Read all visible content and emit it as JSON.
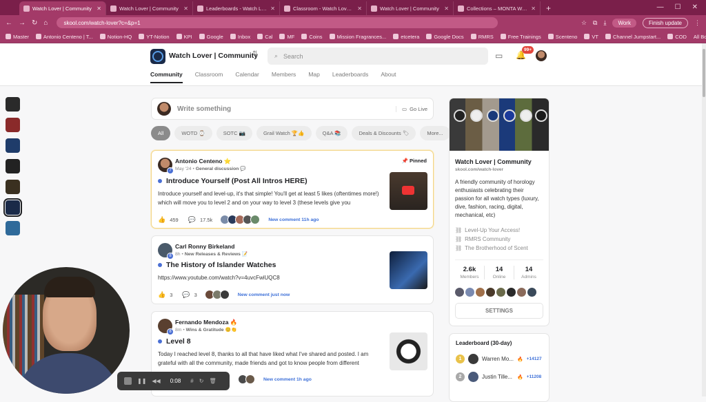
{
  "browser": {
    "tabs": [
      {
        "label": "Watch Lover | Community",
        "active": true
      },
      {
        "label": "Watch Lover | Community",
        "active": false
      },
      {
        "label": "Leaderboards - Watch Lover | C",
        "active": false
      },
      {
        "label": "Classroom - Watch Lover | Com",
        "active": false
      },
      {
        "label": "Watch Lover | Community",
        "active": false
      },
      {
        "label": "Collections – MONTA Watch",
        "active": false
      }
    ],
    "url": "skool.com/watch-lover?c=&p=1",
    "profile": "Work",
    "update_label": "Finish update",
    "bookmarks": [
      "Master",
      "Antonio Centeno | T...",
      "Notion-HQ",
      "YT-Notion",
      "KPI",
      "Google",
      "Inbox",
      "Cal",
      "MF",
      "Coins",
      "Mission Fragrances...",
      "etcetera",
      "Google Docs",
      "RMRS",
      "Free Trainings",
      "Scenteno",
      "VT",
      "Channel Jumpstart...",
      "COD"
    ],
    "all_bookmarks": "All Bookmarks"
  },
  "header": {
    "group_name": "Watch Lover | Community",
    "search_placeholder": "Search",
    "notif_badge": "99+",
    "nav": [
      "Community",
      "Classroom",
      "Calendar",
      "Members",
      "Map",
      "Leaderboards",
      "About"
    ]
  },
  "composer": {
    "placeholder": "Write something",
    "golive": "Go Live"
  },
  "filters": [
    "All",
    "WOTD ⌚",
    "SOTC 📷",
    "Grail Watch 🏆👍",
    "Q&A 📚",
    "Deals & Discounts 🏷",
    "More..."
  ],
  "posts": [
    {
      "author": "Antonio Centeno ⭐",
      "level": "7",
      "time": "May '24 •",
      "category": "General discussion 💬",
      "pinned": "Pinned",
      "title": "Introduce Yourself (Post All Intros HERE)",
      "body": "Introduce yourself and level-up, it's that simple! You'll get at least 5 likes (oftentimes more!) which will move you to level 2 and on your way to level 3 (these levels give you",
      "likes": "459",
      "comments": "17.5k",
      "new_comment": "New comment 11h ago"
    },
    {
      "author": "Carl Ronny Birkeland",
      "level": "8",
      "time": "8h •",
      "category": "New Releases & Reviews 📝",
      "title": "The History of Islander Watches",
      "body": "https://www.youtube.com/watch?v=4uvcFwiUQC8",
      "likes": "3",
      "comments": "3",
      "new_comment": "New comment just now"
    },
    {
      "author": "Fernando Mendoza 🔥",
      "level": "8",
      "time": "8m •",
      "category": "Wins & Gratitude 😊👏",
      "title": "Level 8",
      "body": "Today I reached level 8, thanks to all that have liked what I've shared and posted. I am grateful with all the community, made friends and got to know people from different",
      "new_comment": "New comment 1h ago"
    }
  ],
  "about": {
    "name": "Watch Lover | Community",
    "url": "skool.com/watch-lover",
    "description": "A friendly community of horology enthusiasts celebrating their passion for all watch types (luxury, dive, fashion, racing, digital, mechanical, etc)",
    "links": [
      "Level-Up Your Access!",
      "RMRS Community",
      "The Brotherhood of Scent"
    ],
    "stats": [
      {
        "value": "2.6k",
        "label": "Members"
      },
      {
        "value": "14",
        "label": "Online"
      },
      {
        "value": "14",
        "label": "Admins"
      }
    ],
    "settings_label": "SETTINGS"
  },
  "leaderboard": {
    "title": "Leaderboard (30-day)",
    "rows": [
      {
        "rank": "1",
        "name": "Warren Mo...",
        "points": "+14127",
        "medal_color": "#e9c24a"
      },
      {
        "rank": "2",
        "name": "Justin Tille...",
        "points": "+11208",
        "medal_color": "#a9a9a9"
      }
    ]
  },
  "recorder": {
    "time": "0:08"
  },
  "colors": {
    "accent": "#a33a68",
    "link": "#3c6fd8",
    "pinned_border": "#f2d58a"
  }
}
